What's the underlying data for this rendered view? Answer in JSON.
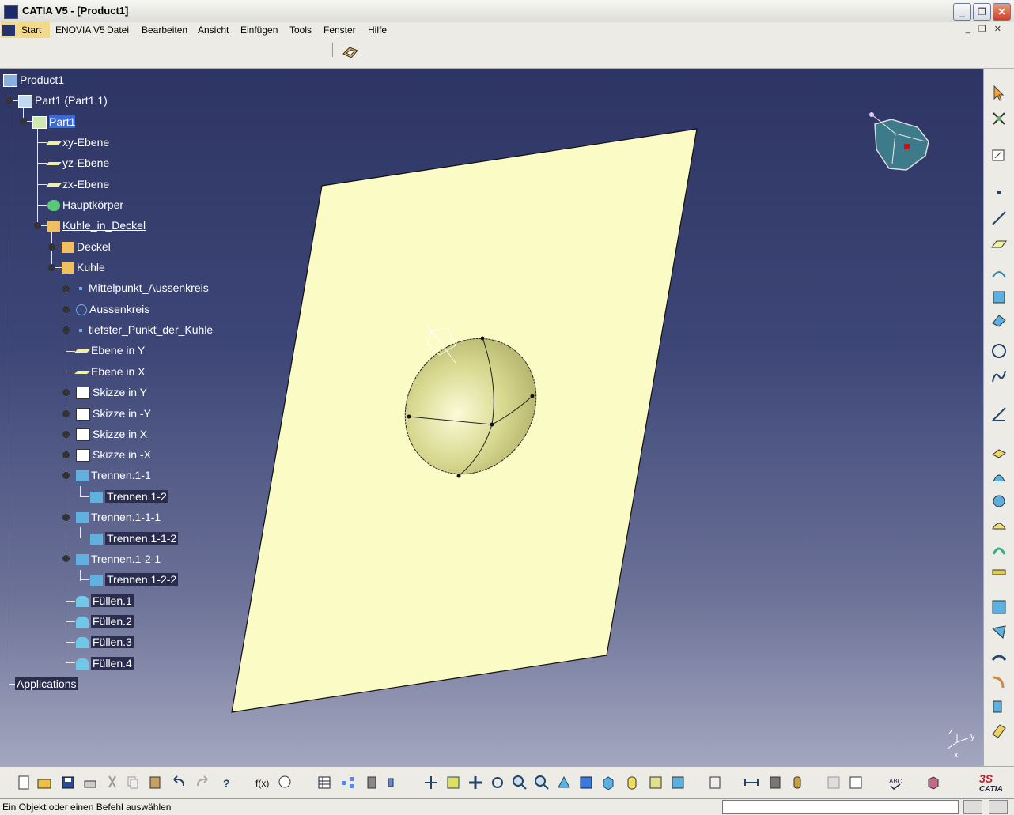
{
  "window": {
    "title": "CATIA V5 - [Product1]"
  },
  "menubar": {
    "items": [
      "Start",
      "ENOVIA V5",
      "Datei",
      "Bearbeiten",
      "Ansicht",
      "Einfügen",
      "Tools",
      "Fenster",
      "Hilfe"
    ]
  },
  "tree": {
    "nodes": [
      {
        "label": "Product1"
      },
      {
        "label": "Part1 (Part1.1)"
      },
      {
        "label": "Part1"
      },
      {
        "label": "xy-Ebene"
      },
      {
        "label": "yz-Ebene"
      },
      {
        "label": "zx-Ebene"
      },
      {
        "label": "Hauptkörper"
      },
      {
        "label": "Kuhle_in_Deckel"
      },
      {
        "label": "Deckel"
      },
      {
        "label": "Kuhle"
      },
      {
        "label": "Mittelpunkt_Aussenkreis"
      },
      {
        "label": "Aussenkreis"
      },
      {
        "label": "tiefster_Punkt_der_Kuhle"
      },
      {
        "label": "Ebene in Y"
      },
      {
        "label": "Ebene in X"
      },
      {
        "label": "Skizze in Y"
      },
      {
        "label": "Skizze in -Y"
      },
      {
        "label": "Skizze in X"
      },
      {
        "label": "Skizze in -X"
      },
      {
        "label": "Trennen.1-1"
      },
      {
        "label": "Trennen.1-2"
      },
      {
        "label": "Trennen.1-1-1"
      },
      {
        "label": "Trennen.1-1-2"
      },
      {
        "label": "Trennen.1-2-1"
      },
      {
        "label": "Trennen.1-2-2"
      },
      {
        "label": "Füllen.1"
      },
      {
        "label": "Füllen.2"
      },
      {
        "label": "Füllen.3"
      },
      {
        "label": "Füllen.4"
      },
      {
        "label": "Applications"
      }
    ]
  },
  "compass": {
    "axes": [
      "x",
      "y",
      "z"
    ]
  },
  "statusbar": {
    "text": "Ein Objekt oder einen Befehl auswählen"
  },
  "brand": {
    "logo": "CATIA"
  },
  "colors": {
    "viewport_top": "#2e3564",
    "viewport_bottom": "#a3a7bf",
    "surface": "#fbfbc5",
    "selection": "#3a6ad8"
  }
}
